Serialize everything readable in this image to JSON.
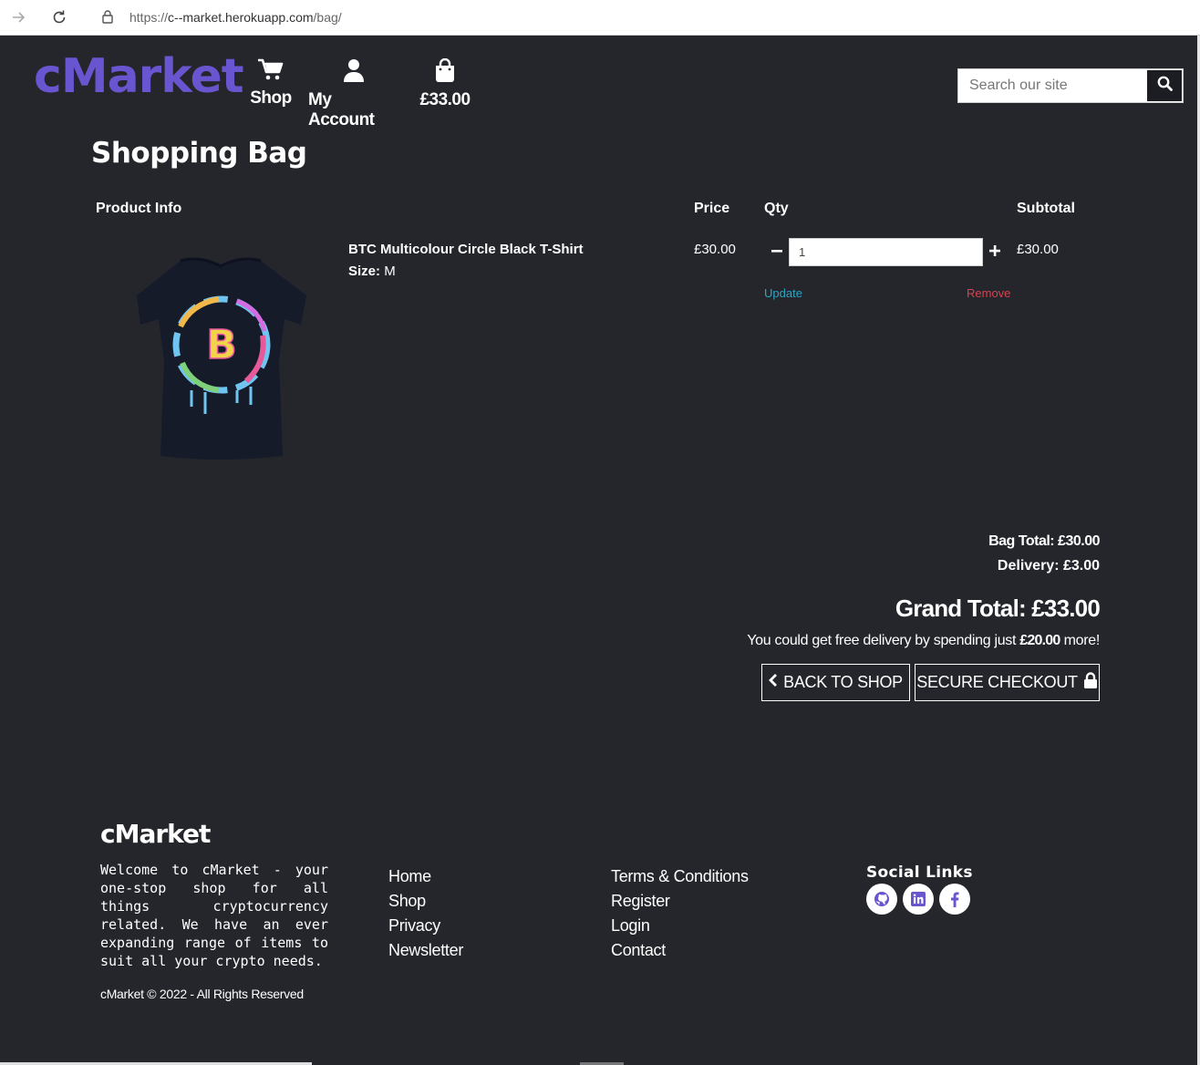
{
  "browser": {
    "url_prefix": "https://",
    "url_host": "c--market.herokuapp.com",
    "url_path": "/bag/"
  },
  "header": {
    "logo": "cMarket",
    "nav": {
      "shop": "Shop",
      "account": "My Account",
      "bag_total": "£33.00"
    },
    "search_placeholder": "Search our site"
  },
  "page": {
    "title": "Shopping Bag"
  },
  "table": {
    "headers": {
      "product_info": "Product Info",
      "price": "Price",
      "qty": "Qty",
      "subtotal": "Subtotal"
    },
    "items": [
      {
        "name": "BTC Multicolour Circle Black T-Shirt",
        "size_label": "Size:",
        "size": "M",
        "price": "£30.00",
        "qty": "1",
        "subtotal": "£30.00",
        "update": "Update",
        "remove": "Remove"
      }
    ]
  },
  "totals": {
    "bag_total": "Bag Total: £30.00",
    "delivery": "Delivery: £3.00",
    "grand_total": "Grand Total: £33.00",
    "free_delivery_prefix": "You could get free delivery by spending just",
    "free_delivery_amount": "£20.00",
    "free_delivery_suffix": "more!"
  },
  "buttons": {
    "back": "BACK TO SHOP",
    "checkout": "SECURE CHECKOUT"
  },
  "footer": {
    "logo": "cMarket",
    "about": "Welcome to cMarket - your one-stop shop for all things cryptocurrency related. We have an ever expanding range of items to suit all your crypto needs.",
    "copyright": "cMarket © 2022 - All Rights Reserved",
    "links_col1": [
      "Home",
      "Shop",
      "Privacy",
      "Newsletter"
    ],
    "links_col2": [
      "Terms & Conditions",
      "Register",
      "Login",
      "Contact"
    ],
    "social_title": "Social Links",
    "social_icons": [
      "github-icon",
      "linkedin-icon",
      "facebook-icon"
    ]
  },
  "colors": {
    "brand": "#6a55d1",
    "background": "#24262c",
    "update": "#2ba6c6",
    "remove": "#d6434e"
  }
}
